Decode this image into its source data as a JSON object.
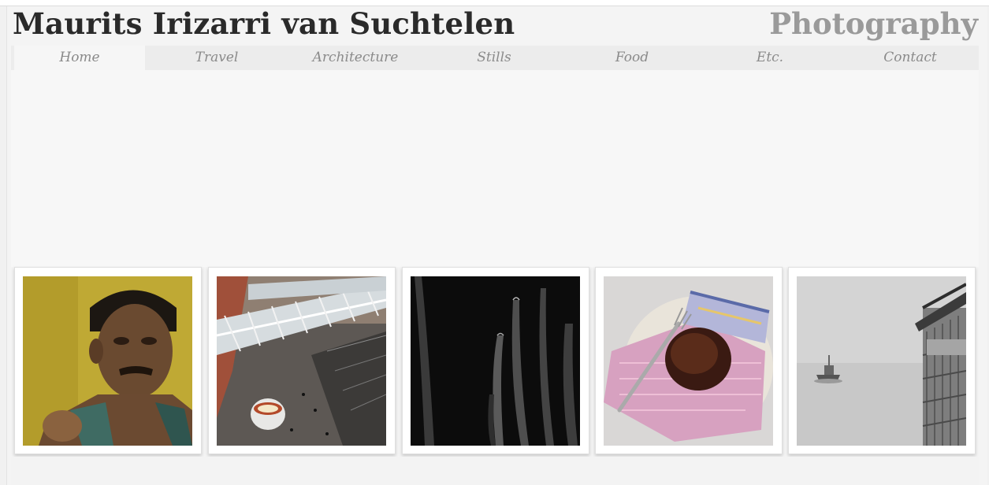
{
  "header": {
    "site_name": "Maurits Irizarri van Suchtelen",
    "tagline": "Photography"
  },
  "nav": {
    "items": [
      {
        "label": "Home",
        "active": true
      },
      {
        "label": "Travel",
        "active": false
      },
      {
        "label": "Architecture",
        "active": false
      },
      {
        "label": "Stills",
        "active": false
      },
      {
        "label": "Food",
        "active": false
      },
      {
        "label": "Etc.",
        "active": false
      },
      {
        "label": "Contact",
        "active": false
      }
    ]
  },
  "gallery": {
    "thumbnails": [
      {
        "subject": "portrait-photo"
      },
      {
        "subject": "architecture-photo"
      },
      {
        "subject": "still-life-photo"
      },
      {
        "subject": "food-photo"
      },
      {
        "subject": "seascape-photo"
      }
    ]
  },
  "colors": {
    "background": "#f1f1f1",
    "site_name": "#2a2a2a",
    "tagline": "#9a9a9a",
    "nav_text": "#8a8a8a"
  }
}
